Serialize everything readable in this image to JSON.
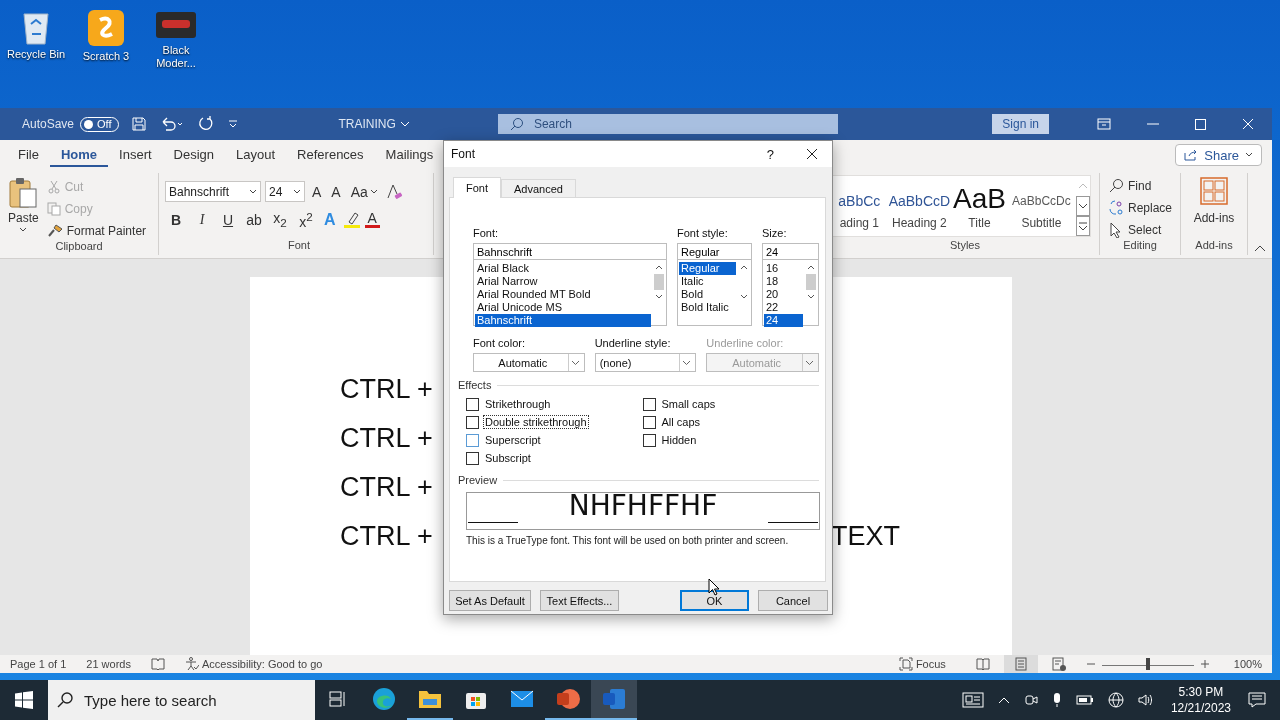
{
  "desktop_icons": [
    {
      "label": "Recycle Bin",
      "kind": "recycle"
    },
    {
      "label": "Scratch 3",
      "kind": "scratch"
    },
    {
      "label": "Black Moder...",
      "kind": "app"
    }
  ],
  "title_bar": {
    "autosave_label": "AutoSave",
    "autosave": {
      "label": "Off",
      "on": false
    },
    "document_title": "TRAINING",
    "search": {
      "placeholder": "Search"
    },
    "sign_in": "Sign in"
  },
  "ribbon_tabs": [
    {
      "label": "File",
      "selected": false
    },
    {
      "label": "Home",
      "selected": true
    },
    {
      "label": "Insert",
      "selected": false
    },
    {
      "label": "Design",
      "selected": false
    },
    {
      "label": "Layout",
      "selected": false
    },
    {
      "label": "References",
      "selected": false
    },
    {
      "label": "Mailings",
      "selected": false
    }
  ],
  "share": "Share",
  "clipboard": {
    "paste": "Paste",
    "items": [
      {
        "label": "Cut",
        "kind": "cut",
        "disabled": true
      },
      {
        "label": "Copy",
        "kind": "copy",
        "disabled": true
      },
      {
        "label": "Format Painter",
        "kind": "painter",
        "disabled": false
      }
    ],
    "group_label": "Clipboard"
  },
  "font_group": {
    "font_name": "Bahnschrift",
    "font_size": "24",
    "grow": "A",
    "shrink": "A",
    "change_case": "Aa",
    "format_buttons": [
      "B",
      "I",
      "U",
      "ab",
      "x$_{2}$",
      "x$^{2}$"
    ],
    "text_effects": "A",
    "font_color": "A",
    "group_label": "Font"
  },
  "styles": {
    "items": [
      {
        "sample": "aBbCc",
        "name": "ading 1",
        "kind": "heading"
      },
      {
        "sample": "AaBbCcD",
        "name": "Heading 2",
        "kind": "heading"
      },
      {
        "sample": "AaB",
        "name": "Title",
        "kind": "title"
      },
      {
        "sample": "AaBbCcDc",
        "name": "Subtitle",
        "kind": "subtitle"
      }
    ],
    "group_label": "Styles"
  },
  "editing": {
    "items": [
      {
        "label": "Find",
        "kind": "find"
      },
      {
        "label": "Replace",
        "kind": "replace"
      },
      {
        "label": "Select",
        "kind": "select"
      }
    ],
    "group_label": "Editing"
  },
  "addins": {
    "label": "Add-ins",
    "group_label": "Add-ins"
  },
  "document": {
    "lines": [
      {
        "left": "CTRL +"
      },
      {
        "left": "CTRL +"
      },
      {
        "left": "CTRL +"
      },
      {
        "left": "CTRL +",
        "right": "TEXT"
      }
    ]
  },
  "dialog": {
    "title": "Font",
    "help": "?",
    "tabs": [
      {
        "label": "Font",
        "selected": true
      },
      {
        "label": "Advanced",
        "selected": false
      }
    ],
    "font": {
      "label": "Font:",
      "value": "Bahnschrift",
      "options": [
        {
          "label": "Arial Black",
          "selected": false
        },
        {
          "label": "Arial Narrow",
          "selected": false
        },
        {
          "label": "Arial Rounded MT Bold",
          "selected": false
        },
        {
          "label": "Arial Unicode MS",
          "selected": false
        },
        {
          "label": "Bahnschrift",
          "selected": true
        }
      ]
    },
    "style": {
      "label": "Font style:",
      "value": "Regular",
      "options": [
        {
          "label": "Regular",
          "selected": true
        },
        {
          "label": "Italic",
          "selected": false
        },
        {
          "label": "Bold",
          "selected": false
        },
        {
          "label": "Bold Italic",
          "selected": false
        }
      ]
    },
    "size": {
      "label": "Size:",
      "value": "24",
      "options": [
        {
          "label": "16",
          "selected": false
        },
        {
          "label": "18",
          "selected": false
        },
        {
          "label": "20",
          "selected": false
        },
        {
          "label": "22",
          "selected": false
        },
        {
          "label": "24",
          "selected": true
        }
      ]
    },
    "selects": [
      {
        "label": "Font color:",
        "value": "Automatic",
        "disabled": false
      },
      {
        "label": "Underline style:",
        "value": "(none)",
        "disabled": false
      },
      {
        "label": "Underline color:",
        "value": "Automatic",
        "disabled": true
      }
    ],
    "effects_label": "Effects",
    "effects_left": [
      {
        "label": "Strikethrough",
        "checked": false,
        "focused": false
      },
      {
        "label": "Double strikethrough",
        "checked": false,
        "focused": true
      },
      {
        "label": "Superscript",
        "checked": false,
        "focused": false
      },
      {
        "label": "Subscript",
        "checked": false,
        "focused": false
      }
    ],
    "effects_right": [
      {
        "label": "Small caps",
        "checked": false,
        "focused": false
      },
      {
        "label": "All caps",
        "checked": false,
        "focused": false
      },
      {
        "label": "Hidden",
        "checked": false,
        "focused": false
      }
    ],
    "preview_label": "Preview",
    "preview_text": "NHFHFFHF",
    "note": "This is a TrueType font. This font will be used on both printer and screen.",
    "buttons": [
      {
        "label": "Set As Default",
        "kind": "secondary"
      },
      {
        "label": "Text Effects...",
        "kind": "secondary"
      },
      {
        "label": "OK",
        "kind": "default"
      },
      {
        "label": "Cancel",
        "kind": "secondary"
      }
    ]
  },
  "status_bar": {
    "page": "Page 1 of 1",
    "words": "21 words",
    "accessibility": "Accessibility: Good to go",
    "focus": "Focus",
    "views": [
      {
        "kind": "read",
        "selected": false
      },
      {
        "kind": "print",
        "selected": true
      },
      {
        "kind": "web",
        "selected": false
      }
    ],
    "zoom": {
      "level": 0.5,
      "reading": "100%"
    }
  },
  "taskbar": {
    "search": {
      "placeholder": "Type here to search"
    },
    "apps": [
      {
        "kind": "taskview",
        "running": false,
        "selected": false
      },
      {
        "kind": "edge",
        "running": false,
        "selected": false
      },
      {
        "kind": "explorer",
        "running": true,
        "selected": false
      },
      {
        "kind": "store",
        "running": false,
        "selected": false
      },
      {
        "kind": "mail",
        "running": false,
        "selected": false
      },
      {
        "kind": "powerpoint",
        "running": true,
        "selected": false
      },
      {
        "kind": "word",
        "running": true,
        "selected": true
      }
    ],
    "time": "5:30 PM",
    "date": "12/21/2023"
  }
}
